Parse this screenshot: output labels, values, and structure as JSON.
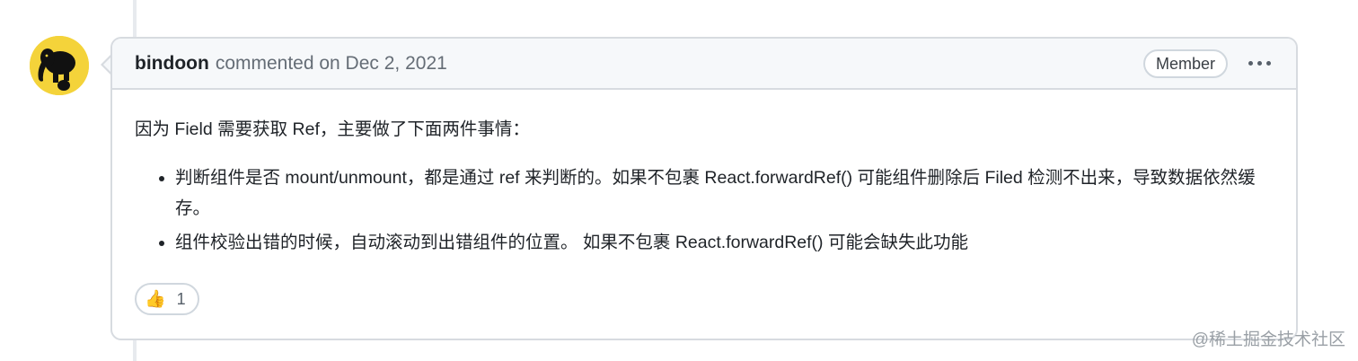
{
  "comment": {
    "author": "bindoon",
    "meta": "commented on Dec 2, 2021",
    "badge": "Member",
    "intro": "因为 Field 需要获取 Ref，主要做了下面两件事情：",
    "bullets": [
      "判断组件是否 mount/unmount，都是通过 ref 来判断的。如果不包裹 React.forwardRef() 可能组件删除后 Filed 检测不出来，导致数据依然缓存。",
      "组件校验出错的时候，自动滚动到出错组件的位置。 如果不包裹 React.forwardRef() 可能会缺失此功能"
    ],
    "reactions": [
      {
        "emoji": "👍",
        "icon": "thumbs-up-icon",
        "count": "1"
      }
    ]
  },
  "watermark": "@稀土掘金技术社区",
  "colors": {
    "avatar_bg": "#f4d33a",
    "header_bg": "#f6f8fa",
    "border": "#d7dbe0",
    "muted_text": "#656d76"
  }
}
